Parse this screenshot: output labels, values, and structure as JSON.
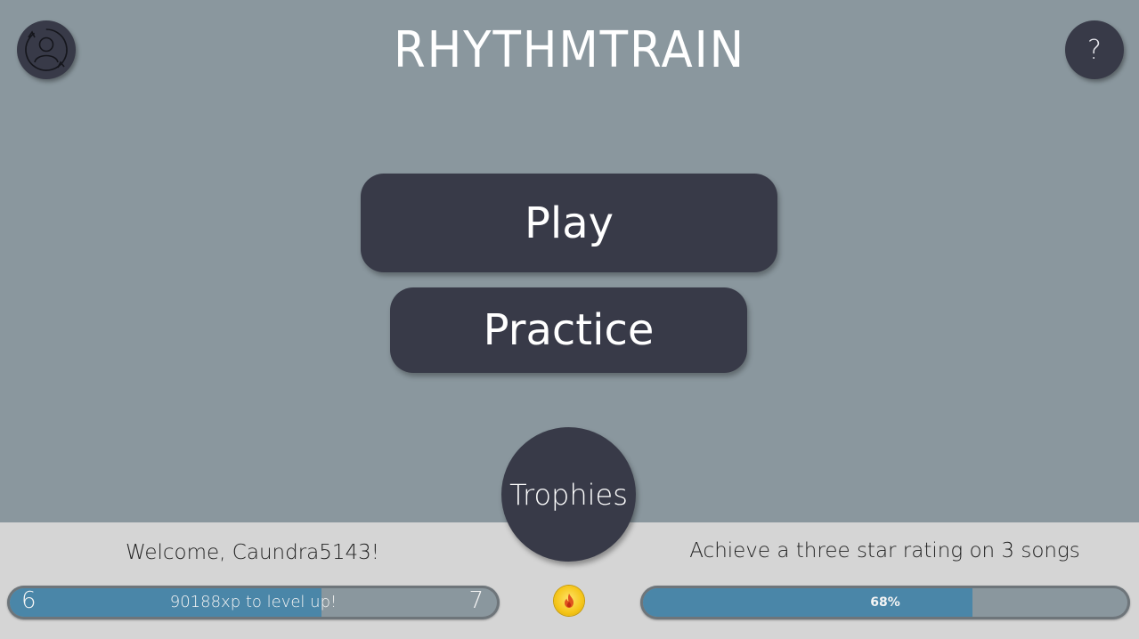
{
  "app": {
    "title": "RHYTHMTRAIN"
  },
  "header": {
    "profile_icon": "profile-switch-icon",
    "help_label": "?"
  },
  "menu": {
    "play_label": "Play",
    "practice_label": "Practice",
    "trophies_label": "Trophies"
  },
  "footer": {
    "welcome": "Welcome, Caundra5143!",
    "level_current": "6",
    "level_next": "7",
    "xp_text": "90188xp to level up!",
    "xp_progress": 0.64,
    "streak_icon": "flame-icon",
    "challenge_text": "Achieve a three star rating on 3 songs",
    "challenge_percent_label": "68%",
    "challenge_progress": 0.68
  },
  "colors": {
    "background": "#8a979e",
    "button": "#383a48",
    "footer": "#d5d5d5",
    "progress_fill": "#4a86a8",
    "streak": "#f5c518"
  }
}
